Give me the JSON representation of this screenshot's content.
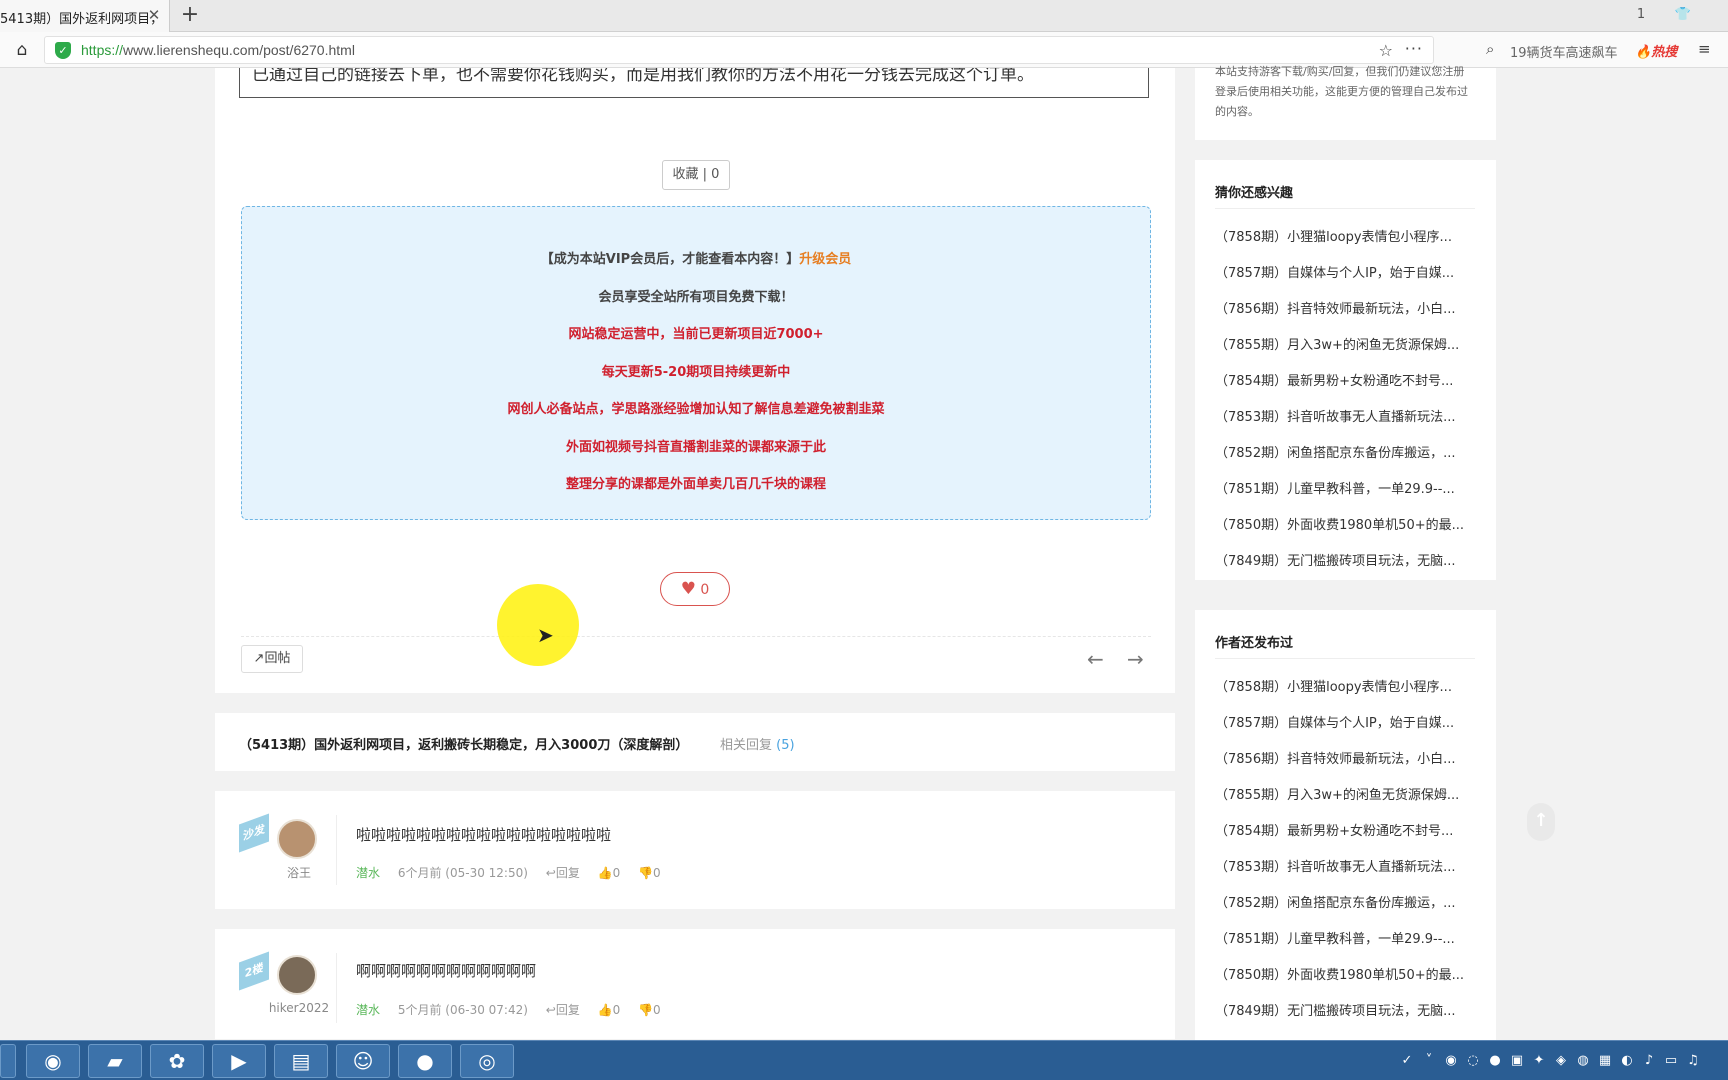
{
  "browser": {
    "tab_title": "5413期）国外返利网项目，",
    "tab_close": "✕",
    "new_tab": "+",
    "url_protocol": "https://",
    "url_rest": "www.lierenshequ.com/post/6270.html",
    "search_text": "19辆货车高速飙车",
    "hot_label": "热搜",
    "win_icon_1": "1",
    "win_icon_2": "👕"
  },
  "article": {
    "quote_text": "已通过自己的链接去下单，也不需要你花钱购买，而是用我们教你的方法不用花一分钱去完成这个订单。",
    "collect_label": "收藏 | 0",
    "vip_notice_prefix": "【成为本站VIP会员后，才能查看本内容！】",
    "vip_upgrade_link": "升级会员",
    "vip_line_2": "会员享受全站所有项目免费下载！",
    "vip_line_3": "网站稳定运营中，当前已更新项目近7000+",
    "vip_line_4": "每天更新5-20期项目持续更新中",
    "vip_line_5": "网创人必备站点，学思路涨经验增加认知了解信息差避免被割韭菜",
    "vip_line_6": "外面如视频号抖音直播割韭菜的课都来源于此",
    "vip_line_7": "整理分享的课都是外面单卖几百几千块的课程",
    "like_count": "0",
    "reply_label": "回帖"
  },
  "topic": {
    "title": "（5413期）国外返利网项目，返利搬砖长期稳定，月入3000刀（深度解剖）",
    "related_label": "相关回复",
    "related_count": "(5)"
  },
  "comments": [
    {
      "floor": "沙发",
      "username": "浴王",
      "text": "啦啦啦啦啦啦啦啦啦啦啦啦啦啦啦啦啦",
      "level": "潜水",
      "time": "6个月前 (05-30 12:50)",
      "reply": "回复",
      "up": "0",
      "down": "0"
    },
    {
      "floor": "2楼",
      "username": "hiker2022",
      "text": "啊啊啊啊啊啊啊啊啊啊啊啊",
      "level": "潜水",
      "time": "5个月前 (06-30 07:42)",
      "reply": "回复",
      "up": "0",
      "down": "0"
    }
  ],
  "sidebar": {
    "top_notice": "本站支持游客下载/购买/回复，但我们仍建议您注册登录后使用相关功能，这能更方便的管理自己发布过的内容。",
    "guess_title": "猜你还感兴趣",
    "author_title": "作者还发布过",
    "guess_items": [
      "（7858期）小狸猫loopy表情包小程序...",
      "（7857期）自媒体与个人IP，始于自媒...",
      "（7856期）抖音特效师最新玩法，小白...",
      "（7855期）月入3w+的闲鱼无货源保姆...",
      "（7854期）最新男粉+女粉通吃不封号...",
      "（7853期）抖音听故事无人直播新玩法...",
      "（7852期）闲鱼搭配京东备份库搬运，...",
      "（7851期）儿童早教科普，一单29.9--...",
      "（7850期）外面收费1980单机50+的最...",
      "（7849期）无门槛搬砖项目玩法，无脑..."
    ],
    "author_items": [
      "（7858期）小狸猫loopy表情包小程序...",
      "（7857期）自媒体与个人IP，始于自媒...",
      "（7856期）抖音特效师最新玩法，小白...",
      "（7855期）月入3w+的闲鱼无货源保姆...",
      "（7854期）最新男粉+女粉通吃不封号...",
      "（7853期）抖音听故事无人直播新玩法...",
      "（7852期）闲鱼搭配京东备份库搬运，...",
      "（7851期）儿童早教科普，一单29.9--...",
      "（7850期）外面收费1980单机50+的最...",
      "（7849期）无门槛搬砖项目玩法，无脑..."
    ]
  },
  "colors": {
    "accent_red": "#d0202e",
    "link_orange": "#e67e22",
    "vip_bg": "#e5f3fd",
    "taskbar": "#2a5d93"
  }
}
